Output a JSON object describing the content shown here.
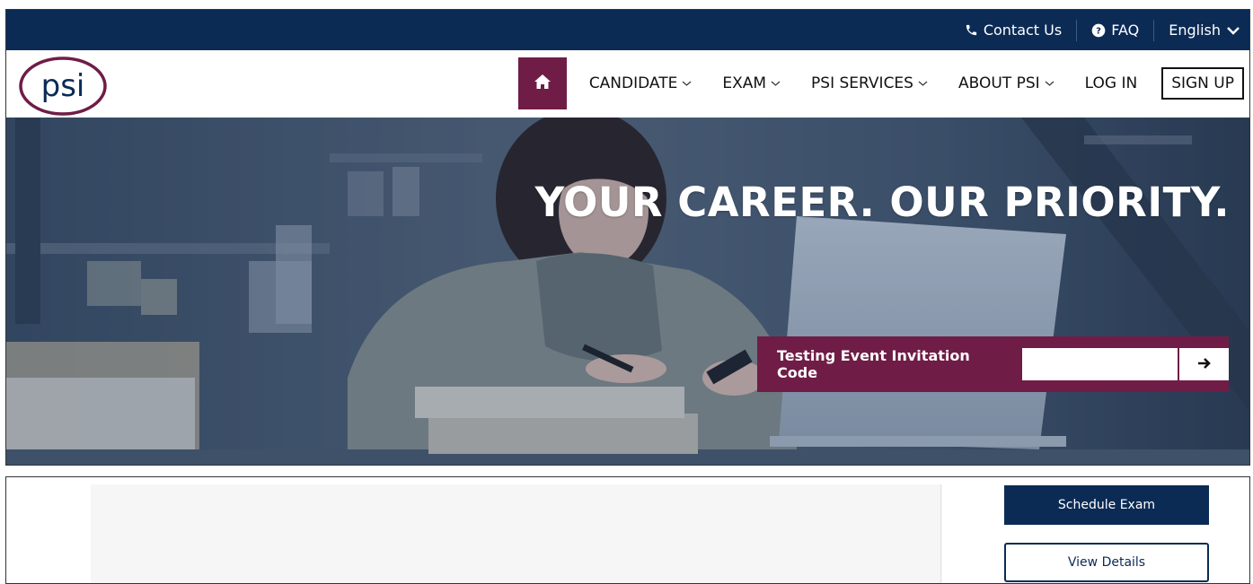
{
  "topbar": {
    "contact": {
      "label": "Contact Us",
      "icon": "phone-icon"
    },
    "faq": {
      "label": "FAQ",
      "icon": "question-circle-icon"
    },
    "language": {
      "label": "English",
      "icon": "chevron-down-icon"
    }
  },
  "logo": {
    "text": "psi"
  },
  "nav": {
    "home_icon": "home-icon",
    "items": [
      {
        "label": "CANDIDATE",
        "dropdown": true
      },
      {
        "label": "EXAM",
        "dropdown": true
      },
      {
        "label": "PSI SERVICES",
        "dropdown": true
      },
      {
        "label": "ABOUT PSI",
        "dropdown": true
      },
      {
        "label": "LOG IN",
        "dropdown": false
      }
    ],
    "signup": "SIGN UP"
  },
  "hero": {
    "headline": "YOUR CAREER. OUR PRIORITY.",
    "invite_label": "Testing Event Invitation Code",
    "invite_value": "",
    "invite_submit_icon": "arrow-right-icon"
  },
  "bottom": {
    "schedule_label": "Schedule Exam",
    "details_label": "View Details"
  },
  "colors": {
    "navy": "#0b2b55",
    "maroon": "#6f1d46",
    "white": "#ffffff"
  }
}
